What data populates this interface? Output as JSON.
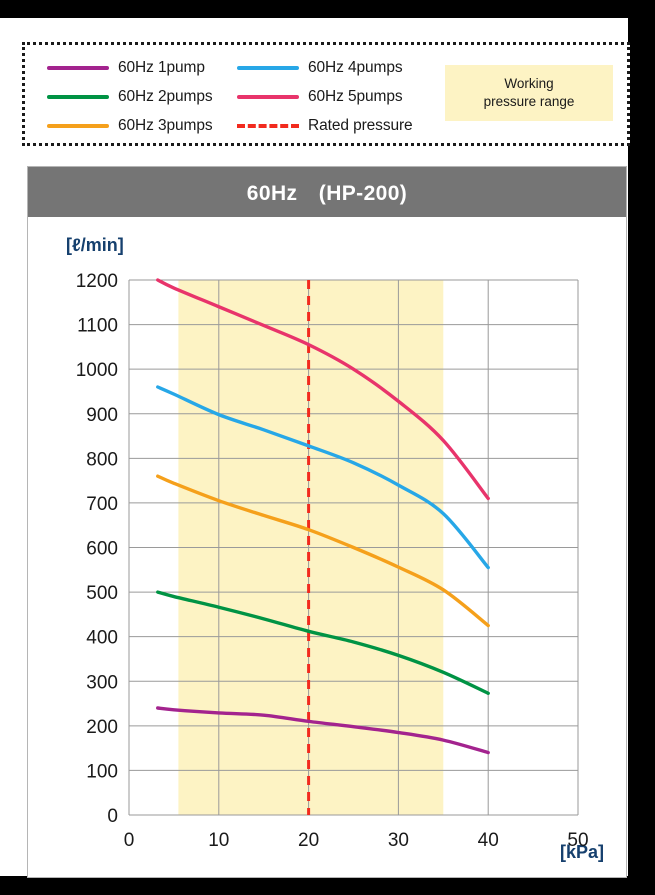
{
  "legend": {
    "entries": [
      {
        "label": "60Hz 1pump",
        "color": "#a3238e",
        "style": "solid",
        "icon": "line-swatch-icon"
      },
      {
        "label": "60Hz 4pumps",
        "color": "#27a7e7",
        "style": "solid",
        "icon": "line-swatch-icon"
      },
      {
        "label": "60Hz 2pumps",
        "color": "#009344",
        "style": "solid",
        "icon": "line-swatch-icon"
      },
      {
        "label": "60Hz 5pumps",
        "color": "#e8346b",
        "style": "solid",
        "icon": "line-swatch-icon"
      },
      {
        "label": "60Hz 3pumps",
        "color": "#f5a01b",
        "style": "solid",
        "icon": "line-swatch-icon"
      },
      {
        "label": "Rated pressure",
        "color": "#f22a1e",
        "style": "dashed",
        "icon": "dashed-line-swatch-icon"
      }
    ],
    "badge": {
      "line1": "Working",
      "line2": "pressure range",
      "background": "#fdf3c4"
    }
  },
  "chart_card": {
    "title": "60Hz　(HP-200)",
    "title_bar_color": "#757575"
  },
  "chart_data": {
    "type": "line",
    "title": "60Hz　(HP-200)",
    "xlabel": "[kPa]",
    "ylabel": "[ℓ/min]",
    "xlim": [
      0,
      50
    ],
    "ylim": [
      0,
      1200
    ],
    "xticks": [
      0,
      10,
      20,
      30,
      40,
      50
    ],
    "yticks": [
      0,
      100,
      200,
      300,
      400,
      500,
      600,
      700,
      800,
      900,
      1000,
      1100,
      1200
    ],
    "grid": true,
    "legend_position": "above-plot",
    "x": [
      3.2,
      5,
      10,
      15,
      20,
      25,
      30,
      35,
      40
    ],
    "series": [
      {
        "name": "60Hz 1pump",
        "color": "#a3238e",
        "values": [
          240,
          236,
          229,
          224,
          210,
          198,
          185,
          168,
          140
        ]
      },
      {
        "name": "60Hz 2pumps",
        "color": "#009344",
        "values": [
          500,
          490,
          466,
          440,
          412,
          388,
          358,
          320,
          273
        ]
      },
      {
        "name": "60Hz 3pumps",
        "color": "#f5a01b",
        "values": [
          760,
          744,
          705,
          672,
          640,
          600,
          556,
          505,
          425
        ]
      },
      {
        "name": "60Hz 4pumps",
        "color": "#27a7e7",
        "values": [
          960,
          944,
          898,
          864,
          828,
          790,
          740,
          676,
          555
        ]
      },
      {
        "name": "60Hz 5pumps",
        "color": "#e8346b",
        "values": [
          1200,
          1182,
          1140,
          1098,
          1055,
          1000,
          928,
          840,
          710
        ]
      }
    ],
    "annotations": [
      {
        "type": "vline",
        "name": "rated-pressure-line",
        "x": 20,
        "color": "#f22a1e",
        "style": "dashed",
        "label": "Rated pressure"
      },
      {
        "type": "vband",
        "name": "working-pressure-band",
        "x0": 5.5,
        "x1": 35,
        "color": "#fdf3c4",
        "label": "Working pressure range"
      }
    ]
  }
}
